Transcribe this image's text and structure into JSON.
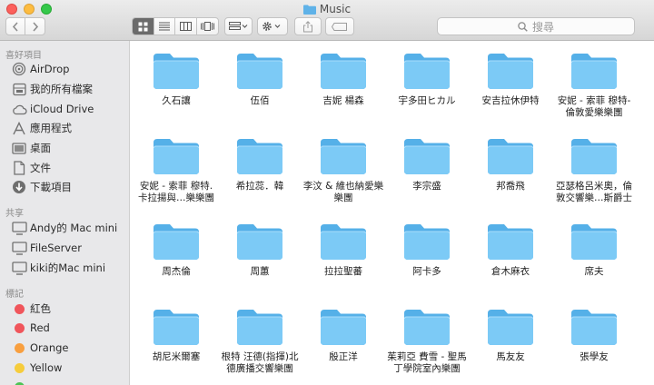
{
  "window": {
    "title": "Music"
  },
  "toolbar": {
    "search_placeholder": "搜尋"
  },
  "sidebar": {
    "favorites_header": "喜好項目",
    "favorites": [
      {
        "label": "AirDrop",
        "icon": "airdrop-icon"
      },
      {
        "label": "我的所有檔案",
        "icon": "all-files-icon"
      },
      {
        "label": "iCloud Drive",
        "icon": "cloud-icon"
      },
      {
        "label": "應用程式",
        "icon": "applications-icon"
      },
      {
        "label": "桌面",
        "icon": "desktop-icon"
      },
      {
        "label": "文件",
        "icon": "documents-icon"
      },
      {
        "label": "下載項目",
        "icon": "downloads-icon"
      }
    ],
    "shared_header": "共享",
    "shared": [
      {
        "label": "Andy的 Mac mini",
        "icon": "computer-icon"
      },
      {
        "label": "FileServer",
        "icon": "computer-icon"
      },
      {
        "label": "kiki的Mac mini",
        "icon": "computer-icon"
      }
    ],
    "tags_header": "標記",
    "tags": [
      {
        "label": "紅色",
        "color": "#f0555b"
      },
      {
        "label": "Red",
        "color": "#f0555b"
      },
      {
        "label": "Orange",
        "color": "#f89f3f"
      },
      {
        "label": "Yellow",
        "color": "#f6cc3c"
      }
    ]
  },
  "folders": [
    {
      "lines": [
        "久石讓"
      ]
    },
    {
      "lines": [
        "伍佰"
      ]
    },
    {
      "lines": [
        "吉妮 楊森"
      ]
    },
    {
      "lines": [
        "宇多田ヒカル"
      ]
    },
    {
      "lines": [
        "安吉拉休伊特"
      ]
    },
    {
      "lines": [
        "安妮 - 索菲 穆特-",
        "倫敦愛樂樂團"
      ]
    },
    {
      "lines": [
        "安妮 - 索菲 穆特.",
        "卡拉揚與…樂樂團"
      ]
    },
    {
      "lines": [
        "希拉蕊．韓"
      ]
    },
    {
      "lines": [
        "李汶 & 維也納愛樂",
        "樂團"
      ]
    },
    {
      "lines": [
        "李宗盛"
      ]
    },
    {
      "lines": [
        "邦喬飛"
      ]
    },
    {
      "lines": [
        "亞瑟格呂米奧，倫",
        "敦交響樂…斯爵士"
      ]
    },
    {
      "lines": [
        "周杰倫"
      ]
    },
    {
      "lines": [
        "周蕙"
      ]
    },
    {
      "lines": [
        "拉拉聖蕃"
      ]
    },
    {
      "lines": [
        "阿卡多"
      ]
    },
    {
      "lines": [
        "倉木麻衣"
      ]
    },
    {
      "lines": [
        "席夫"
      ]
    },
    {
      "lines": [
        "胡尼米爾塞"
      ]
    },
    {
      "lines": [
        "根特 汪德(指揮)北",
        "德廣播交響樂團"
      ]
    },
    {
      "lines": [
        "殷正洋"
      ]
    },
    {
      "lines": [
        "茱莉亞 費雪 - 聖馬",
        "丁學院室內樂團"
      ]
    },
    {
      "lines": [
        "馬友友"
      ]
    },
    {
      "lines": [
        "張學友"
      ]
    }
  ]
}
